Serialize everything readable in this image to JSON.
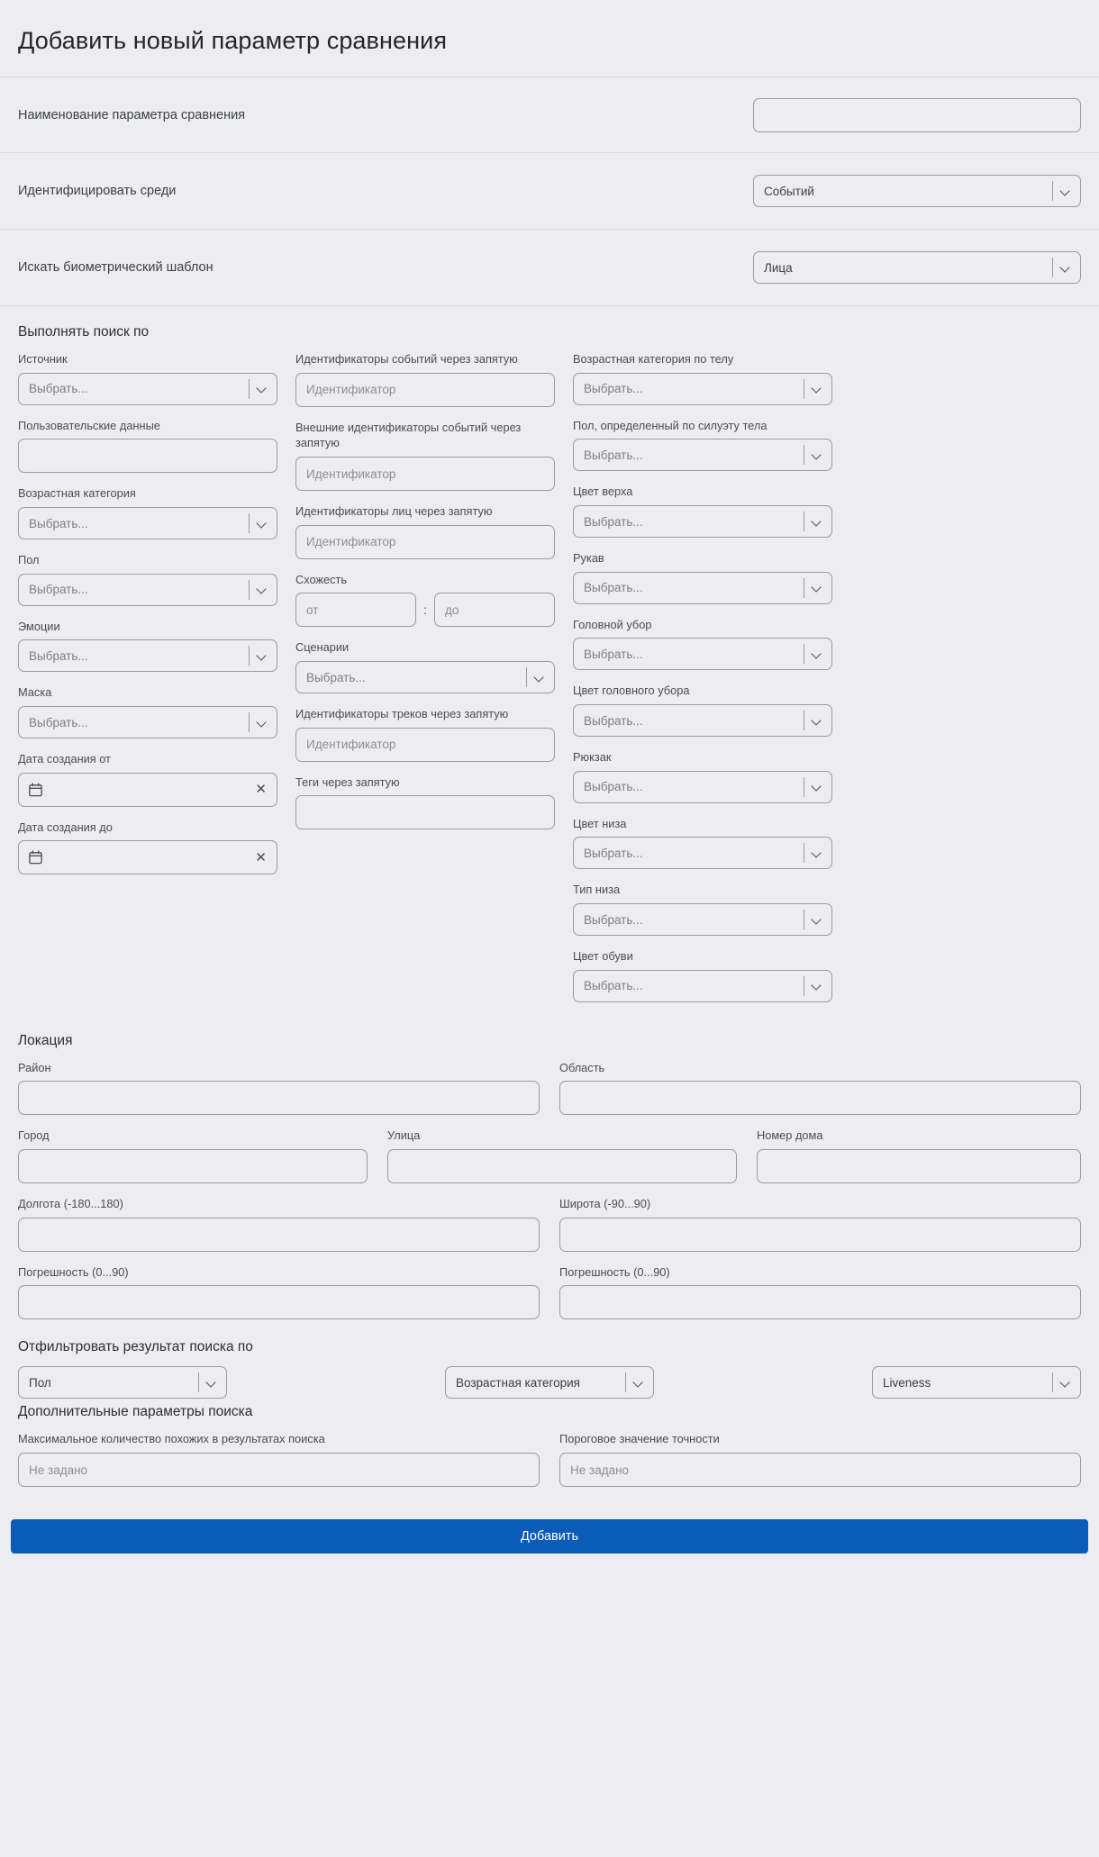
{
  "page": {
    "title": "Добавить новый параметр сравнения"
  },
  "top_rows": [
    {
      "label": "Наименование параметра сравнения",
      "control": "input",
      "value": "",
      "placeholder": ""
    },
    {
      "label": "Идентифицировать среди",
      "control": "select",
      "value": "Событий"
    },
    {
      "label": "Искать биометрический шаблон",
      "control": "select",
      "value": "Лица"
    }
  ],
  "search_section": {
    "title": "Выполнять поиск по",
    "col_left": [
      {
        "label": "Источник",
        "type": "select",
        "value": "Выбрать..."
      },
      {
        "label": "Пользовательские данные",
        "type": "input",
        "placeholder": ""
      },
      {
        "label": "Возрастная категория",
        "type": "select",
        "value": "Выбрать..."
      },
      {
        "label": "Пол",
        "type": "select",
        "value": "Выбрать..."
      },
      {
        "label": "Эмоции",
        "type": "select",
        "value": "Выбрать..."
      },
      {
        "label": "Маска",
        "type": "select",
        "value": "Выбрать..."
      },
      {
        "label": "Дата создания от",
        "type": "date",
        "value": ""
      },
      {
        "label": "Дата создания до",
        "type": "date",
        "value": ""
      }
    ],
    "col_middle": [
      {
        "label": "Идентификаторы событий через запятую",
        "type": "input",
        "placeholder": "Идентификатор"
      },
      {
        "label": "Внешние идентификаторы событий через запятую",
        "type": "input",
        "placeholder": "Идентификатор"
      },
      {
        "label": "Идентификаторы лиц через запятую",
        "type": "input",
        "placeholder": "Идентификатор"
      },
      {
        "label": "Схожесть",
        "type": "range",
        "placeholder_from": "от",
        "placeholder_to": "до",
        "separator": ":"
      },
      {
        "label": "Сценарии",
        "type": "select",
        "value": "Выбрать..."
      },
      {
        "label": "Идентификаторы треков через запятую",
        "type": "input",
        "placeholder": "Идентификатор"
      },
      {
        "label": "Теги через запятую",
        "type": "input",
        "placeholder": ""
      }
    ],
    "col_right": [
      {
        "label": "Возрастная категория по телу",
        "type": "select",
        "value": "Выбрать..."
      },
      {
        "label": "Пол, определенный по силуэту тела",
        "type": "select",
        "value": "Выбрать..."
      },
      {
        "label": "Цвет верха",
        "type": "select",
        "value": "Выбрать..."
      },
      {
        "label": "Рукав",
        "type": "select",
        "value": "Выбрать..."
      },
      {
        "label": "Головной убор",
        "type": "select",
        "value": "Выбрать..."
      },
      {
        "label": "Цвет головного убора",
        "type": "select",
        "value": "Выбрать..."
      },
      {
        "label": "Рюкзак",
        "type": "select",
        "value": "Выбрать..."
      },
      {
        "label": "Цвет низа",
        "type": "select",
        "value": "Выбрать..."
      },
      {
        "label": "Тип низа",
        "type": "select",
        "value": "Выбрать..."
      },
      {
        "label": "Цвет обуви",
        "type": "select",
        "value": "Выбрать..."
      }
    ]
  },
  "location": {
    "title": "Локация",
    "row1": [
      {
        "label": "Район",
        "value": ""
      },
      {
        "label": "Область",
        "value": ""
      }
    ],
    "row2": [
      {
        "label": "Город",
        "value": ""
      },
      {
        "label": "Улица",
        "value": ""
      },
      {
        "label": "Номер дома",
        "value": ""
      }
    ],
    "row3": [
      {
        "label": "Долгота (-180...180)",
        "value": ""
      },
      {
        "label": "Широта (-90...90)",
        "value": ""
      }
    ],
    "row4": [
      {
        "label": "Погрешность (0...90)",
        "value": ""
      },
      {
        "label": "Погрешность (0...90)",
        "value": ""
      }
    ]
  },
  "filter_section": {
    "title": "Отфильтровать результат поиска по",
    "selects": [
      {
        "value": "Пол"
      },
      {
        "value": "Возрастная категория"
      },
      {
        "value": "Liveness"
      }
    ]
  },
  "extra_section": {
    "title": "Дополнительные параметры поиска",
    "fields": [
      {
        "label": "Максимальное количество похожих в результатах поиска",
        "placeholder": "Не задано",
        "value": ""
      },
      {
        "label": "Пороговое значение точности",
        "placeholder": "Не задано",
        "value": ""
      }
    ]
  },
  "footer": {
    "submit_label": "Добавить",
    "accent_color": "#0a5cb8"
  }
}
